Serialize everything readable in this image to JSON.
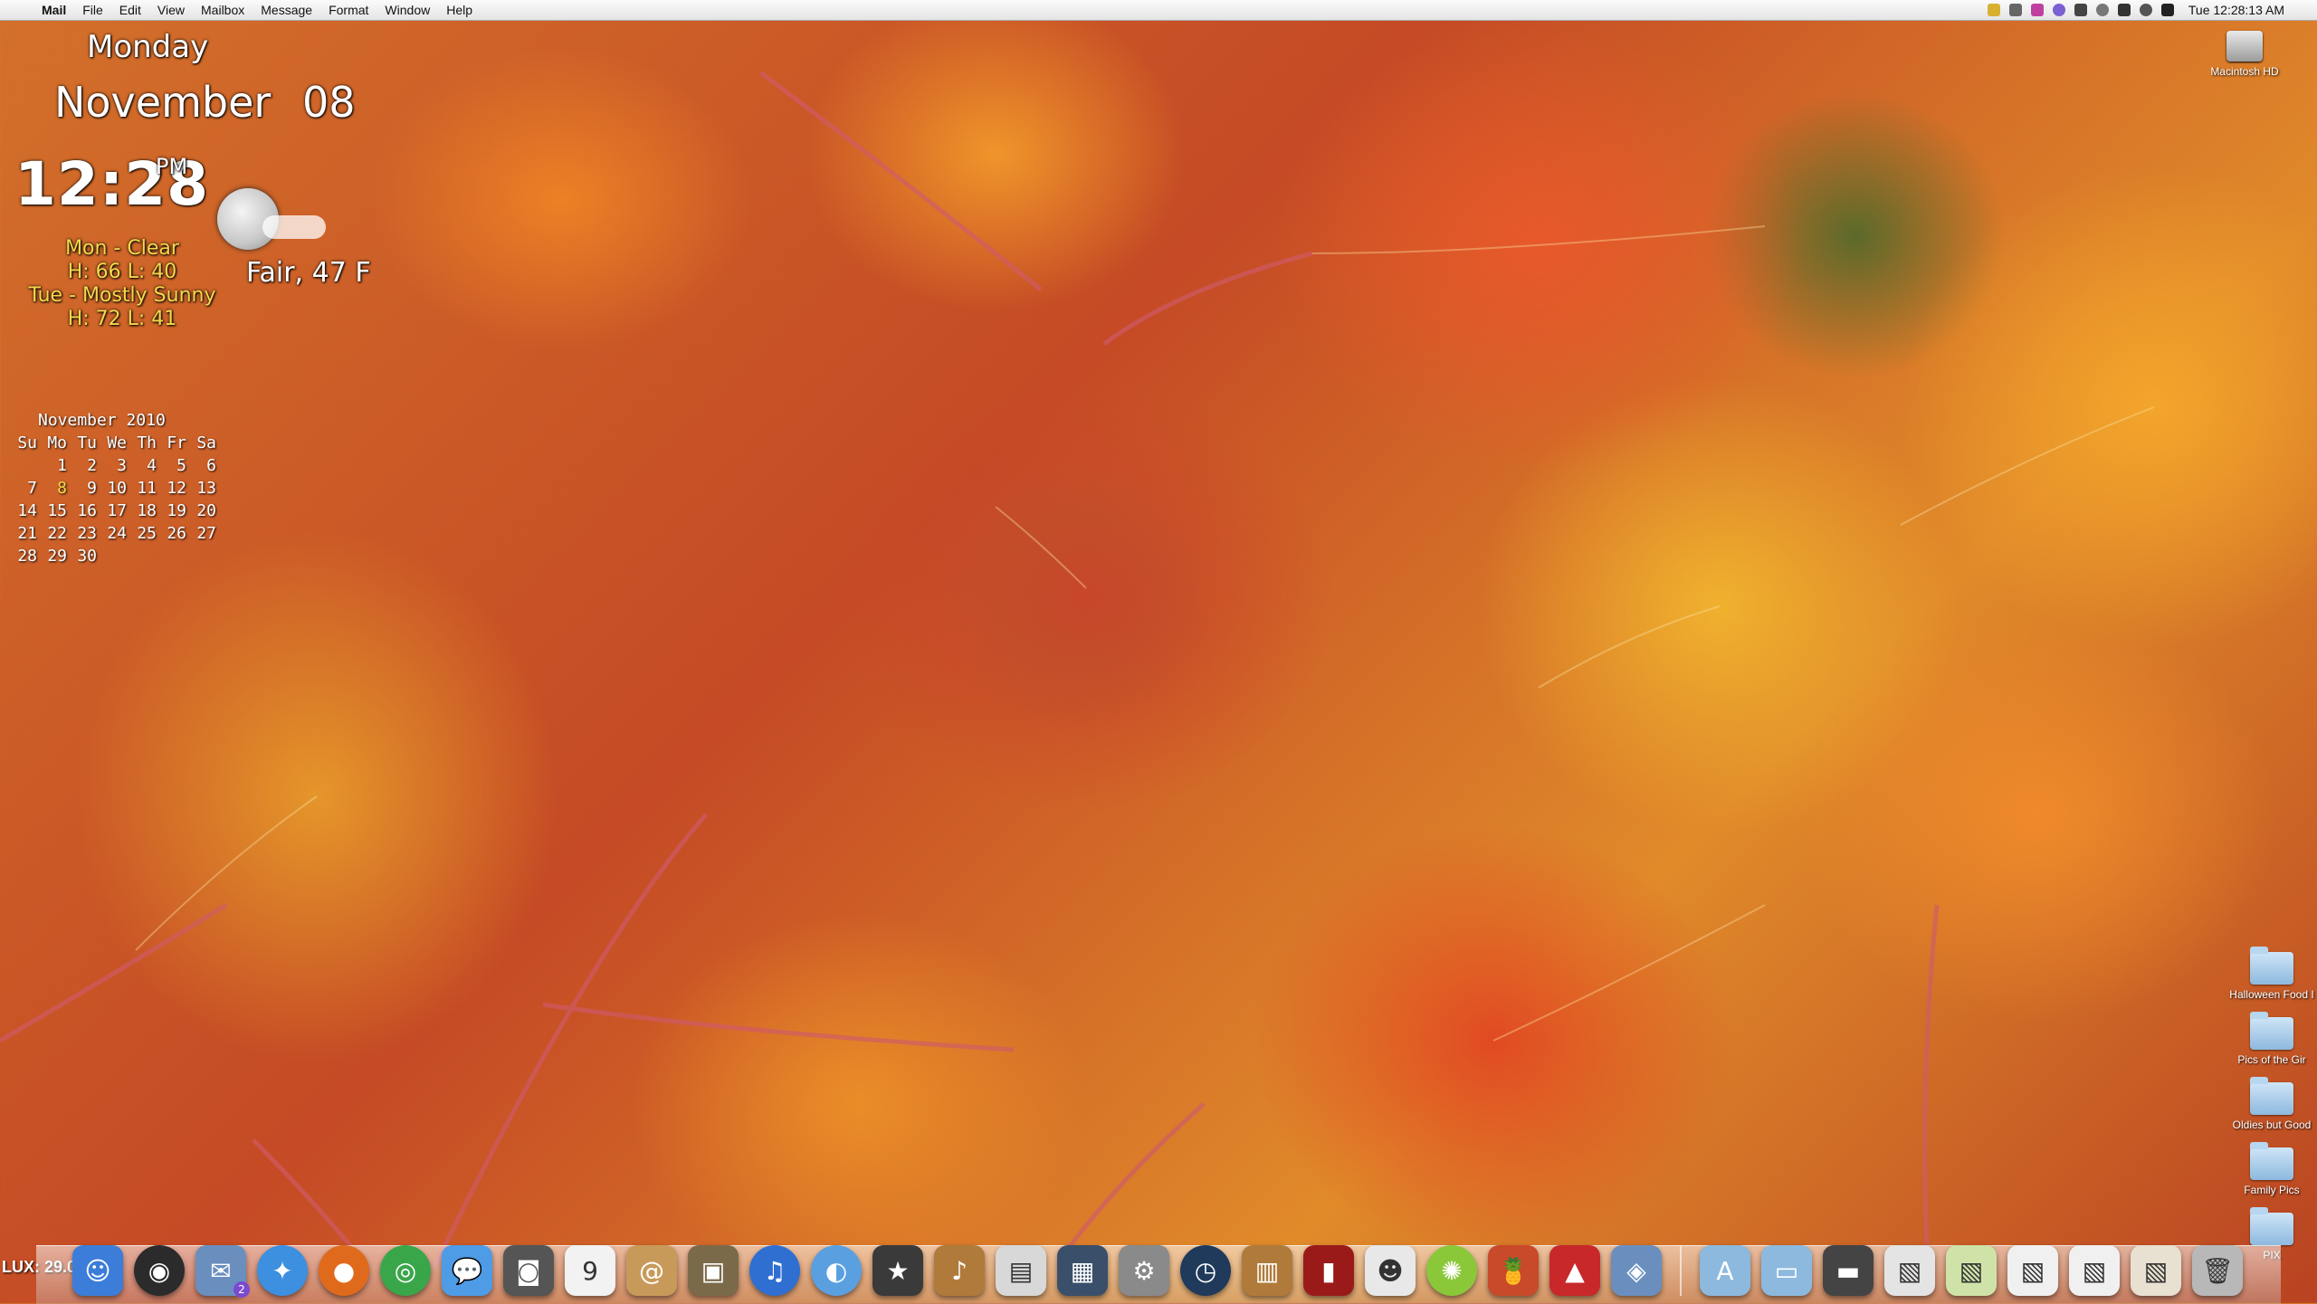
{
  "menubar": {
    "app_name": "Mail",
    "items": [
      "File",
      "Edit",
      "View",
      "Mailbox",
      "Message",
      "Format",
      "Window",
      "Help"
    ],
    "clock": "Tue 12:28:13 AM",
    "status_icons": [
      "battery-icon",
      "script-icon",
      "star-icon",
      "user-icon",
      "display-icon",
      "time-machine-icon",
      "volume-icon",
      "sync-icon",
      "wifi-icon"
    ]
  },
  "widgets": {
    "day": "Monday",
    "month": "November",
    "date": "08",
    "time": "12:28",
    "ampm": "PM",
    "forecast": [
      {
        "line1": "Mon - Clear",
        "line2": "H: 66  L: 40"
      },
      {
        "line1": "Tue - Mostly Sunny",
        "line2": "H: 72  L: 41"
      }
    ],
    "current": "Fair, 47 F"
  },
  "calendar": {
    "title": "November 2010",
    "weekdays": [
      "Su",
      "Mo",
      "Tu",
      "We",
      "Th",
      "Fr",
      "Sa"
    ],
    "weeks": [
      [
        "",
        "1",
        "2",
        "3",
        "4",
        "5",
        "6"
      ],
      [
        "7",
        "8",
        "9",
        "10",
        "11",
        "12",
        "13"
      ],
      [
        "14",
        "15",
        "16",
        "17",
        "18",
        "19",
        "20"
      ],
      [
        "21",
        "22",
        "23",
        "24",
        "25",
        "26",
        "27"
      ],
      [
        "28",
        "29",
        "30",
        "",
        "",
        "",
        ""
      ]
    ],
    "today": "8"
  },
  "desktop": {
    "hd": "Macintosh HD",
    "folders": [
      "Halloween Food I",
      "Pics of the Gir",
      "Oldies but Good",
      "Family Pics",
      "PIX"
    ]
  },
  "lux": "LUX: 29.0",
  "dock": {
    "apps": [
      {
        "name": "finder-icon",
        "color": "#3b7dd8",
        "glyph": "☺"
      },
      {
        "name": "dashboard-icon",
        "color": "#2b2b2b",
        "glyph": "◉"
      },
      {
        "name": "mail-icon",
        "color": "#6a8fbf",
        "glyph": "✉",
        "badge": "2"
      },
      {
        "name": "safari-icon",
        "color": "#3d8fe0",
        "glyph": "✦"
      },
      {
        "name": "firefox-icon",
        "color": "#e06a1c",
        "glyph": "●"
      },
      {
        "name": "chrome-icon",
        "color": "#3aa64a",
        "glyph": "◎"
      },
      {
        "name": "ichat-icon",
        "color": "#4e9be6",
        "glyph": "💬"
      },
      {
        "name": "facetime-icon",
        "color": "#555555",
        "glyph": "◙"
      },
      {
        "name": "ical-icon",
        "color": "#f2f2f2",
        "glyph": "9"
      },
      {
        "name": "address-book-icon",
        "color": "#c89a5a",
        "glyph": "@"
      },
      {
        "name": "iphoto-icon",
        "color": "#7b6a4a",
        "glyph": "▣"
      },
      {
        "name": "itunes-icon",
        "color": "#2f6fd1",
        "glyph": "♫"
      },
      {
        "name": "dvd-player-icon",
        "color": "#5aa0e0",
        "glyph": "◐"
      },
      {
        "name": "imovie-icon",
        "color": "#3a3a3a",
        "glyph": "★"
      },
      {
        "name": "garageband-icon",
        "color": "#b07a3a",
        "glyph": "♪"
      },
      {
        "name": "preview-icon",
        "color": "#d8d8d8",
        "glyph": "▤"
      },
      {
        "name": "spaces-icon",
        "color": "#3a4f6a",
        "glyph": "▦"
      },
      {
        "name": "system-preferences-icon",
        "color": "#8a8a8a",
        "glyph": "⚙"
      },
      {
        "name": "time-machine-icon",
        "color": "#1f3a5a",
        "glyph": "◷"
      },
      {
        "name": "bucket-icon",
        "color": "#b07a3a",
        "glyph": "▥"
      },
      {
        "name": "photo-booth-icon",
        "color": "#9a1a1a",
        "glyph": "▮"
      },
      {
        "name": "app-grin-icon",
        "color": "#e8e8e8",
        "glyph": "☻"
      },
      {
        "name": "lime-icon",
        "color": "#8ac83a",
        "glyph": "✺"
      },
      {
        "name": "cocktail-icon",
        "color": "#c84a2a",
        "glyph": "🍍"
      },
      {
        "name": "stamp-icon",
        "color": "#c8282a",
        "glyph": "▲"
      },
      {
        "name": "preview-photo-icon",
        "color": "#6a8fbf",
        "glyph": "◈"
      }
    ],
    "stacks": [
      {
        "name": "applications-stack-icon",
        "color": "#8db9de",
        "glyph": "A"
      },
      {
        "name": "documents-stack-icon",
        "color": "#8db9de",
        "glyph": "▭"
      },
      {
        "name": "downloads-stack-icon",
        "color": "#444444",
        "glyph": "▬"
      },
      {
        "name": "window-thumb-1-icon",
        "color": "#e4e4e4",
        "glyph": "▧"
      },
      {
        "name": "window-thumb-2-icon",
        "color": "#cfe3a8",
        "glyph": "▧"
      },
      {
        "name": "window-thumb-3-icon",
        "color": "#f0f0f0",
        "glyph": "▧"
      },
      {
        "name": "window-thumb-4-icon",
        "color": "#f0f0f0",
        "glyph": "▧"
      },
      {
        "name": "window-thumb-5-icon",
        "color": "#e8e0d0",
        "glyph": "▧"
      },
      {
        "name": "trash-icon",
        "color": "#b8b8b8",
        "glyph": "🗑"
      }
    ]
  }
}
